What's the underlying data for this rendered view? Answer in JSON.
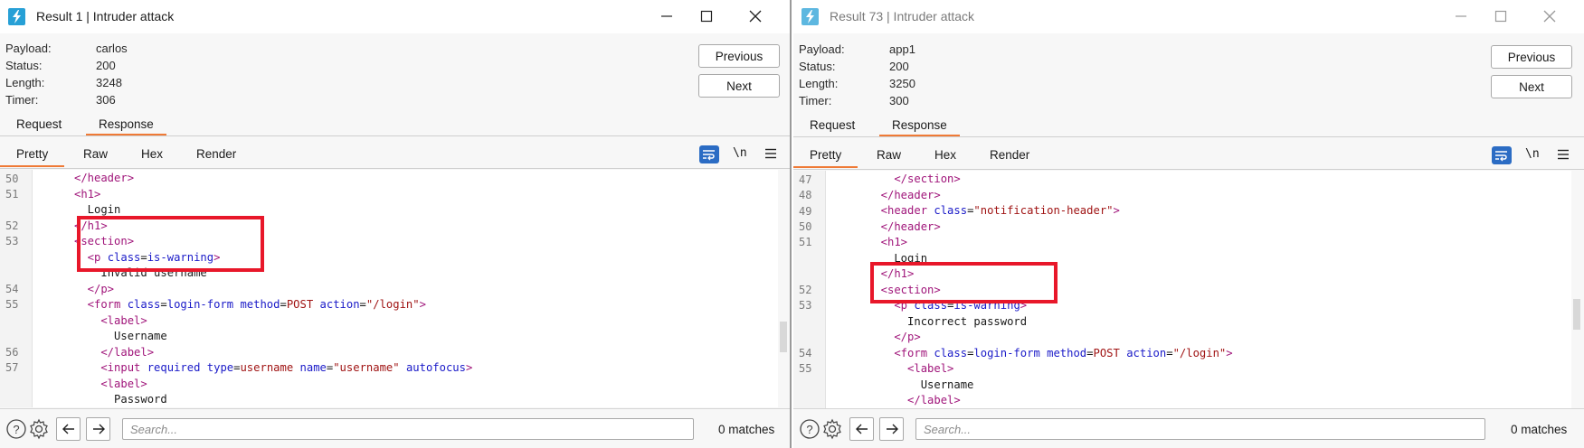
{
  "windows": [
    {
      "title": "Result 1 | Intruder attack",
      "meta": [
        {
          "key": "Payload:",
          "value": "carlos"
        },
        {
          "key": "Status:",
          "value": "200"
        },
        {
          "key": "Length:",
          "value": "3248"
        },
        {
          "key": "Timer:",
          "value": "306"
        }
      ],
      "previous_label": "Previous",
      "next_label": "Next",
      "tabs": {
        "request": "Request",
        "response": "Response"
      },
      "views": {
        "pretty": "Pretty",
        "raw": "Raw",
        "hex": "Hex",
        "render": "Render"
      },
      "newline_toggle": "\\n",
      "search_placeholder": "Search...",
      "matches": "0 matches",
      "line_numbers": [
        "50",
        "51",
        "52",
        "53",
        "54",
        "55",
        "56",
        "57"
      ],
      "highlighted_text": "Invalid username"
    },
    {
      "title": "Result 73 | Intruder attack",
      "meta": [
        {
          "key": "Payload:",
          "value": "app1"
        },
        {
          "key": "Status:",
          "value": "200"
        },
        {
          "key": "Length:",
          "value": "3250"
        },
        {
          "key": "Timer:",
          "value": "300"
        }
      ],
      "previous_label": "Previous",
      "next_label": "Next",
      "tabs": {
        "request": "Request",
        "response": "Response"
      },
      "views": {
        "pretty": "Pretty",
        "raw": "Raw",
        "hex": "Hex",
        "render": "Render"
      },
      "newline_toggle": "\\n",
      "search_placeholder": "Search...",
      "matches": "0 matches",
      "line_numbers": [
        "47",
        "48",
        "49",
        "50",
        "51",
        "52",
        "53",
        "54",
        "55"
      ],
      "highlighted_text": "Incorrect password"
    }
  ],
  "colors": {
    "accent_tab": "#ef7a36",
    "highlight_box": "#e8172a",
    "wrap_icon": "#2b6cc4",
    "app_icon": "#27a0d6"
  },
  "icons": [
    "burp-app-icon",
    "minimize-icon",
    "maximize-icon",
    "close-icon",
    "word-wrap-icon",
    "newline-icon",
    "menu-icon",
    "help-icon",
    "settings-icon",
    "arrow-left-icon",
    "arrow-right-icon"
  ]
}
